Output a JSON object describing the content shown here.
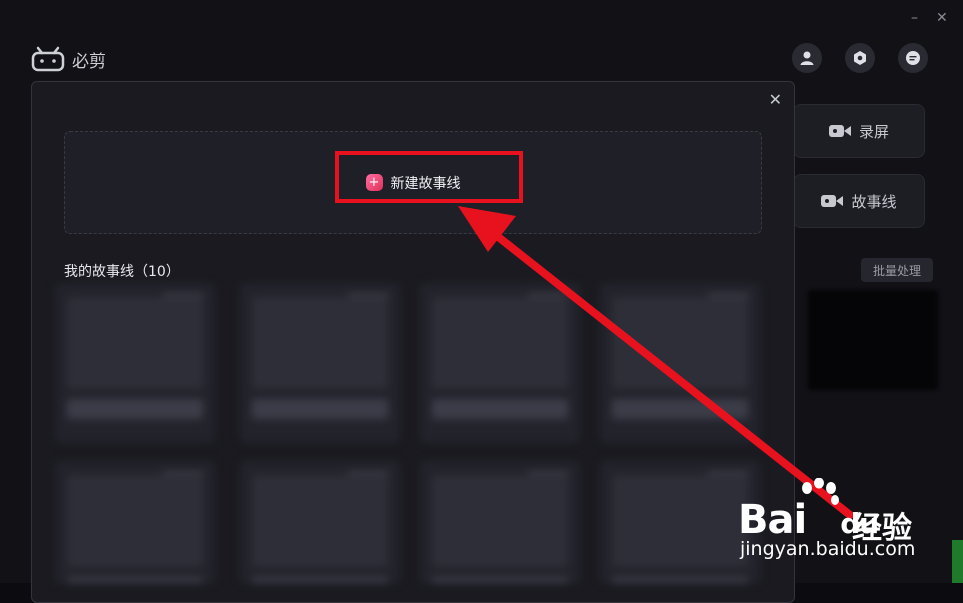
{
  "window": {
    "minimize_glyph": "–",
    "close_glyph": "✕"
  },
  "app": {
    "title": "必剪"
  },
  "sidebar": {
    "record_label": "录屏",
    "storyline_label": "故事线",
    "batch_label": "批量处理"
  },
  "modal": {
    "close_glyph": "✕",
    "new_storyline_label": "新建故事线",
    "my_storylines_title": "我的故事线（10）"
  },
  "annotation": {
    "color": "#e8121f"
  },
  "watermark": {
    "brand": "Bai",
    "brand_tail": "du",
    "product": "经验",
    "url": "jingyan.baidu.com"
  },
  "icons": [
    "bilibili-tv-icon",
    "user-icon",
    "settings-icon",
    "message-icon",
    "camera-icon",
    "video-icon",
    "plus-icon"
  ]
}
